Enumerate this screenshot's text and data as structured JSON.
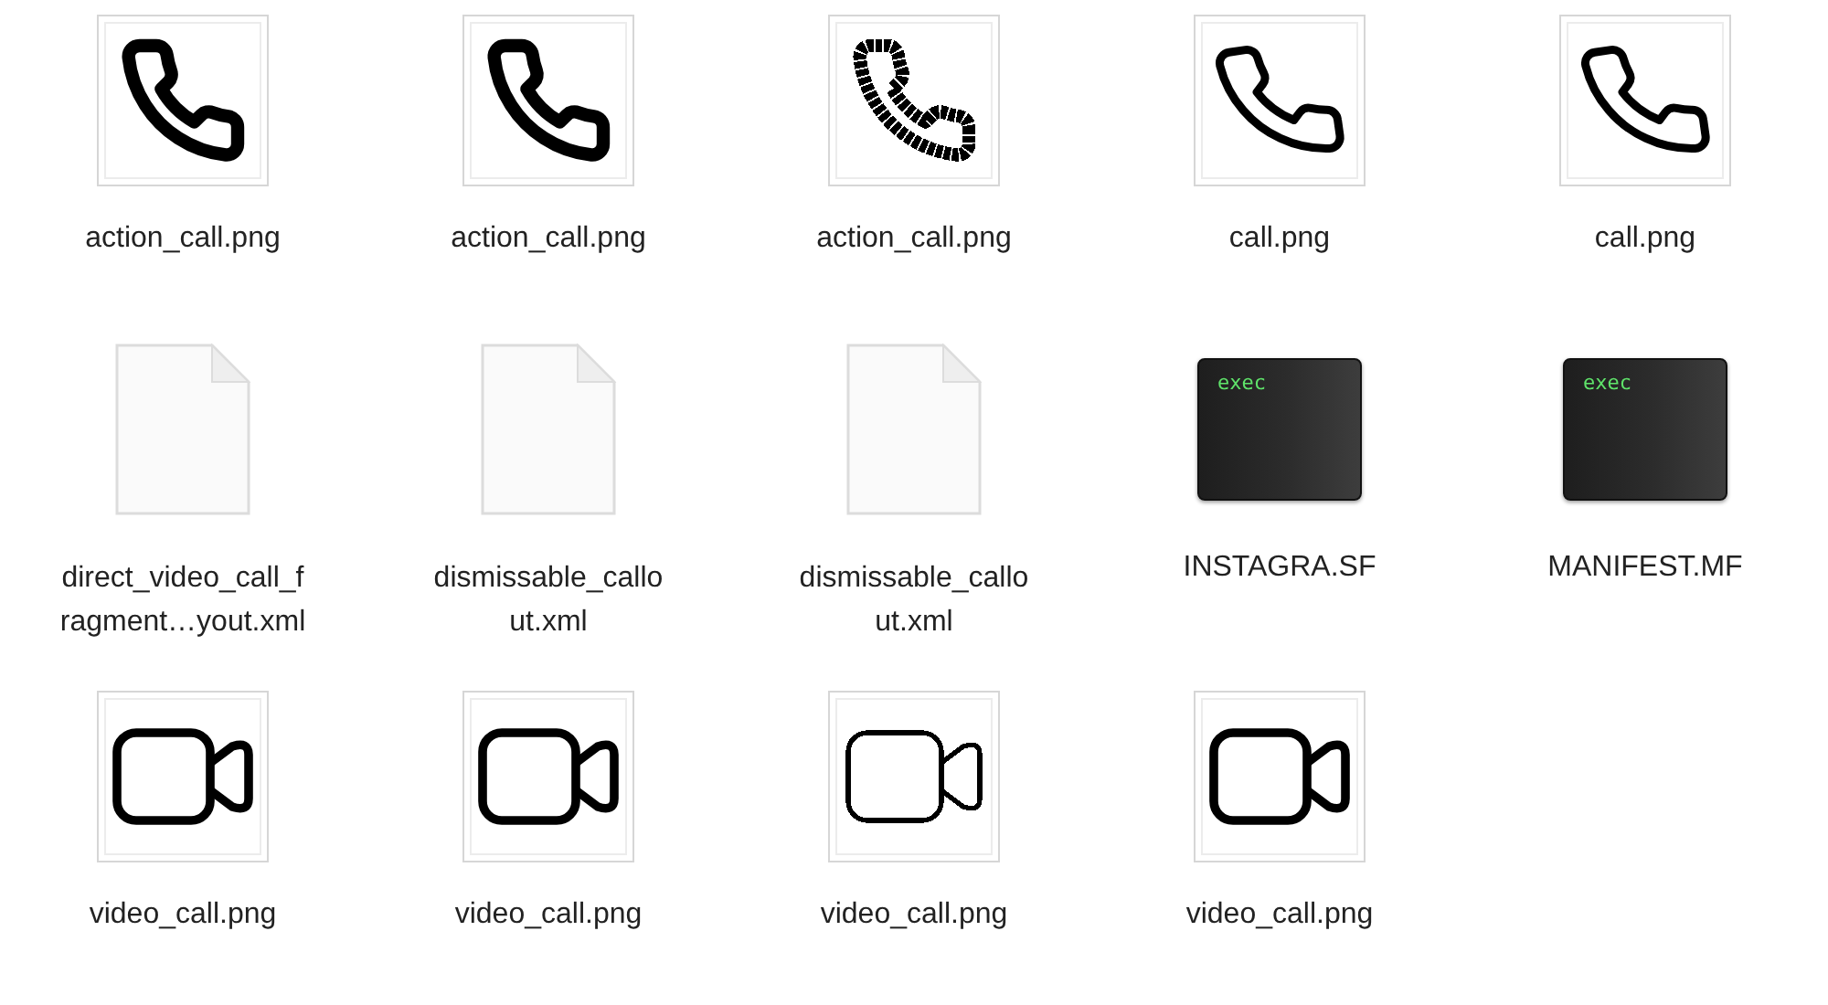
{
  "files": [
    {
      "kind": "phone-thick",
      "pixelated": false,
      "label_lines": [
        "action_call.png"
      ]
    },
    {
      "kind": "phone-thick",
      "pixelated": false,
      "label_lines": [
        "action_call.png"
      ]
    },
    {
      "kind": "phone-thick",
      "pixelated": true,
      "label_lines": [
        "action_call.png"
      ]
    },
    {
      "kind": "phone-thin",
      "pixelated": false,
      "label_lines": [
        "call.png"
      ]
    },
    {
      "kind": "phone-thin",
      "pixelated": false,
      "label_lines": [
        "call.png"
      ]
    },
    {
      "kind": "document",
      "label_lines": [
        "direct_video_call_f",
        "ragment…yout.xml"
      ]
    },
    {
      "kind": "document",
      "label_lines": [
        "dismissable_callo",
        "ut.xml"
      ]
    },
    {
      "kind": "document",
      "label_lines": [
        "dismissable_callo",
        "ut.xml"
      ]
    },
    {
      "kind": "exec",
      "badge": "exec",
      "label_lines": [
        "INSTAGRA.SF"
      ]
    },
    {
      "kind": "exec",
      "badge": "exec",
      "label_lines": [
        "MANIFEST.MF"
      ]
    },
    {
      "kind": "video",
      "pixelated": false,
      "label_lines": [
        "video_call.png"
      ]
    },
    {
      "kind": "video",
      "pixelated": false,
      "label_lines": [
        "video_call.png"
      ]
    },
    {
      "kind": "video",
      "pixelated": true,
      "label_lines": [
        "video_call.png"
      ]
    },
    {
      "kind": "video",
      "pixelated": false,
      "label_lines": [
        "video_call.png"
      ]
    }
  ]
}
